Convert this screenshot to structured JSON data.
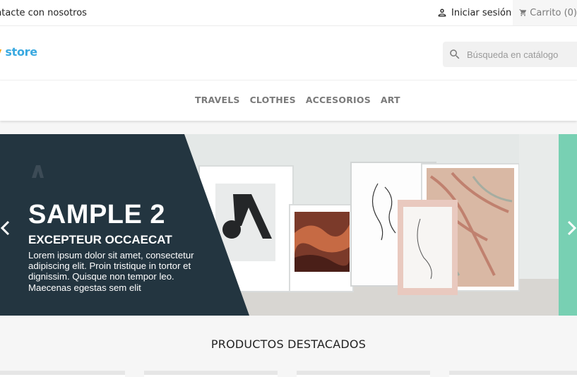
{
  "topbar": {
    "contact_label": "ntacte con nosotros",
    "signin_label": "Iniciar sesión",
    "cart_label": "Carrito (0)",
    "icons": {
      "signin": "user-icon",
      "cart": "shopping-cart-icon"
    }
  },
  "header": {
    "logo": {
      "part1": "y",
      "part2": "store"
    },
    "search": {
      "placeholder": "Búsqueda en catálogo",
      "value": "",
      "icon": "search-icon"
    }
  },
  "menu": {
    "items": [
      {
        "label": "TRAVELS"
      },
      {
        "label": "CLOTHES"
      },
      {
        "label": "ACCESORIOS"
      },
      {
        "label": "ART"
      }
    ]
  },
  "slider": {
    "title": "SAMPLE 2",
    "subtitle": "EXCEPTEUR OCCAECAT",
    "description": "Lorem ipsum dolor sit amet, consectetur adipiscing elit. Proin tristique in tortor et dignissim. Quisque non tempor leo. Maecenas egestas sem elit",
    "prev_icon": "chevron-left-icon",
    "next_icon": "chevron-right-icon",
    "colors": {
      "panel": "#233540",
      "accent_strip": "#78d0b3"
    }
  },
  "featured": {
    "title": "PRODUCTOS DESTACADOS"
  }
}
